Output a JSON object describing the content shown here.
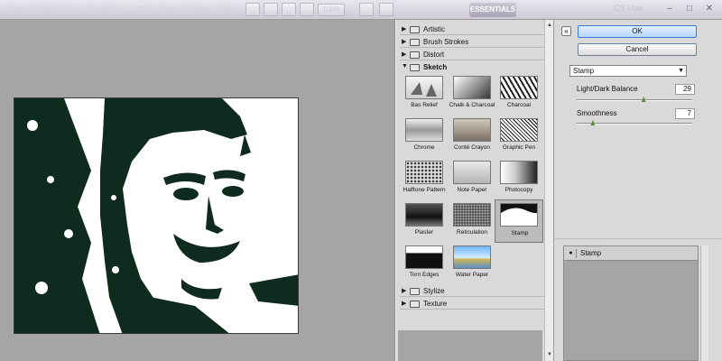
{
  "menubar": {
    "items": [
      "Layer",
      "Select",
      "Filter",
      "Analysis",
      "3D",
      "View",
      "Window",
      "Help"
    ],
    "zoom": "100%",
    "workspace": "ESSENTIALS",
    "cs_live": "CS Live"
  },
  "gallery": {
    "folders_top": [
      {
        "label": "Artistic",
        "expanded": false
      },
      {
        "label": "Brush Strokes",
        "expanded": false
      },
      {
        "label": "Distort",
        "expanded": false
      }
    ],
    "open_folder": {
      "label": "Sketch",
      "expanded": true
    },
    "thumbnails": [
      {
        "label": "Bas Relief"
      },
      {
        "label": "Chalk & Charcoal"
      },
      {
        "label": "Charcoal"
      },
      {
        "label": "Chrome"
      },
      {
        "label": "Conté Crayon"
      },
      {
        "label": "Graphic Pen"
      },
      {
        "label": "Halftone Pattern"
      },
      {
        "label": "Note Paper"
      },
      {
        "label": "Photocopy"
      },
      {
        "label": "Plaster"
      },
      {
        "label": "Reticulation"
      },
      {
        "label": "Stamp",
        "selected": true
      },
      {
        "label": "Torn Edges"
      },
      {
        "label": "Water Paper"
      }
    ],
    "folders_bottom": [
      {
        "label": "Stylize",
        "expanded": false
      },
      {
        "label": "Texture",
        "expanded": false
      }
    ]
  },
  "settings": {
    "ok_label": "OK",
    "cancel_label": "Cancel",
    "selected_filter": "Stamp",
    "params": [
      {
        "label": "Light/Dark Balance",
        "value": "29",
        "fraction": 0.58
      },
      {
        "label": "Smoothness",
        "value": "7",
        "fraction": 0.14
      }
    ],
    "effect_layer": "Stamp"
  },
  "colors": {
    "ink": "#0f2a1f",
    "selected_thumb": "#bcbcbc",
    "ok_accent": "#3a7ad6"
  }
}
